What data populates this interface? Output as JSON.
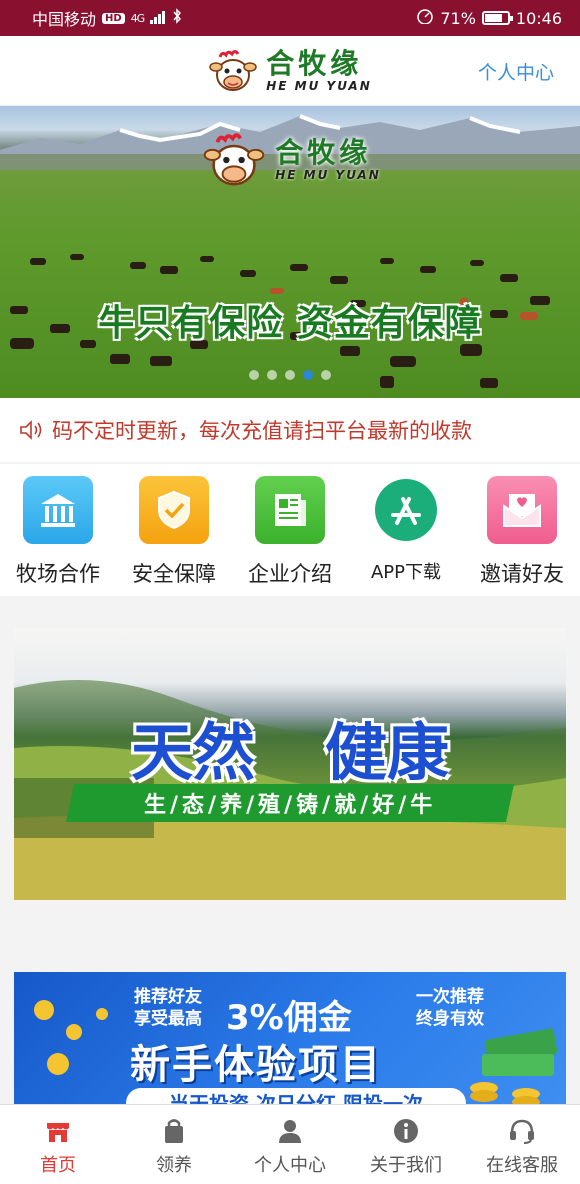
{
  "status_bar": {
    "carrier": "中国移动",
    "hd": "HD",
    "network": "4G",
    "battery": "71%",
    "time": "10:46"
  },
  "header": {
    "logo_cn": "合牧缘",
    "logo_en": "HE MU YUAN",
    "link": "个人中心"
  },
  "banner": {
    "logo_cn": "合牧缘",
    "logo_en": "HE MU YUAN",
    "slogan": "牛只有保险 资金有保障",
    "slide_count": 5,
    "active_slide": 4
  },
  "notice": {
    "text": "码不定时更新，每次充值请扫平台最新的收款"
  },
  "menu": {
    "items": [
      {
        "label": "牧场合作",
        "icon": "bank-icon",
        "color": "#34b6f0"
      },
      {
        "label": "安全保障",
        "icon": "shield-check-icon",
        "color": "#f7b21f"
      },
      {
        "label": "企业介绍",
        "icon": "newspaper-icon",
        "color": "#4fc23e"
      },
      {
        "label": "APP下载",
        "icon": "app-store-icon",
        "color": "#1cae7a"
      },
      {
        "label": "邀请好友",
        "icon": "envelope-heart-icon",
        "color": "#f46a9a"
      }
    ]
  },
  "promo1": {
    "title_left": "天然",
    "title_right": "健康",
    "ribbon": "生/态/养/殖/铸/就/好/牛"
  },
  "promo2": {
    "line1a": "推荐好友",
    "line1b": "享受最高",
    "big": "3%佣金",
    "line2a": "一次推荐",
    "line2b": "终身有效",
    "title": "新手体验项目",
    "bottom": "当天投资 次日分红 限投一次"
  },
  "bottom_nav": {
    "items": [
      {
        "label": "首页",
        "icon": "storefront-icon",
        "active": true
      },
      {
        "label": "领养",
        "icon": "shopping-bag-icon",
        "active": false
      },
      {
        "label": "个人中心",
        "icon": "user-icon",
        "active": false
      },
      {
        "label": "关于我们",
        "icon": "info-icon",
        "active": false
      },
      {
        "label": "在线客服",
        "icon": "headset-icon",
        "active": false
      }
    ]
  },
  "colors": {
    "status_bar": "#8a1030",
    "brand_green": "#1f7a25",
    "accent_blue": "#3a8ed8",
    "notice_red": "#c0392b",
    "nav_active": "#e53935"
  }
}
